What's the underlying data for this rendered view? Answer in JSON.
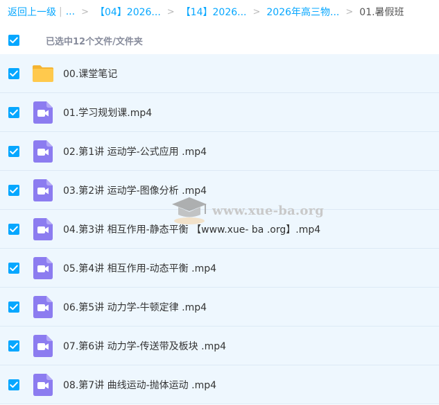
{
  "breadcrumb": {
    "back": "返回上一级",
    "pipe": "|",
    "ellipsis": "...",
    "sep": ">",
    "crumbs": [
      "【04】2026...",
      "【14】2026...",
      "2026年高三物..."
    ],
    "current": "01.暑假班"
  },
  "selection": {
    "summary": "已选中12个文件/文件夹"
  },
  "files": [
    {
      "name": "00.课堂笔记",
      "type": "folder"
    },
    {
      "name": "01.学习规划课.mp4",
      "type": "video"
    },
    {
      "name": "02.第1讲 运动学-公式应用 .mp4",
      "type": "video"
    },
    {
      "name": "03.第2讲 运动学-图像分析 .mp4",
      "type": "video"
    },
    {
      "name": "04.第3讲 相互作用-静态平衡 【www.xue- ba .org】.mp4",
      "type": "video"
    },
    {
      "name": "05.第4讲 相互作用-动态平衡 .mp4",
      "type": "video"
    },
    {
      "name": "06.第5讲 动力学-牛顿定律 .mp4",
      "type": "video"
    },
    {
      "name": "07.第6讲 动力学-传送带及板块 .mp4",
      "type": "video"
    },
    {
      "name": "08.第7讲 曲线运动-抛体运动 .mp4",
      "type": "video"
    }
  ],
  "watermark": {
    "text": "www.xue-ba.org"
  },
  "colors": {
    "accent": "#06a7ff",
    "row_selected": "#eef7fe",
    "folder": "#ffc94d",
    "video": "#8c7cf0"
  },
  "icons": {
    "checkbox": "check-icon",
    "folder": "folder-icon",
    "video": "video-file-icon",
    "watermark": "graduation-cap-icon"
  }
}
